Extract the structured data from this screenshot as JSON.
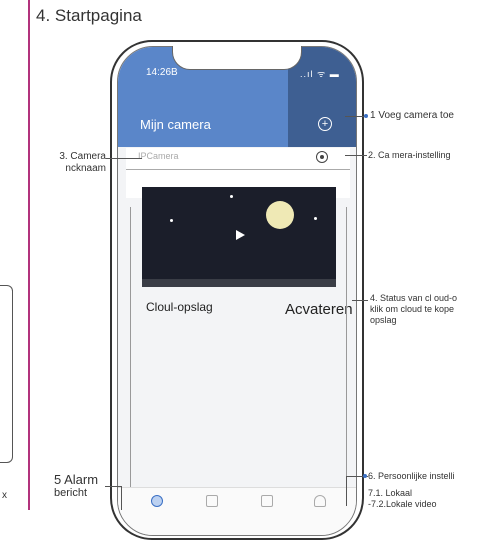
{
  "page": {
    "title": "4. Startpagina"
  },
  "phone": {
    "status_time": "14:26B",
    "status_icons": "..ıl ᯤ ▬",
    "header_title": "Mijn camera",
    "camera_nickname": "IPCamera",
    "cloud_label": "Cloul-opslag",
    "activate_label": "Acvateren",
    "tabs": [
      "camera",
      "alarm",
      "gallery",
      "profile"
    ]
  },
  "callouts": {
    "c1": "1 Voeg camera toe",
    "c2": "2. Ca mera-instelling",
    "c3_line1": "3. Camera",
    "c3_line2": "ncknaam",
    "c4_line1": "4. Status van cl oud-o",
    "c4_line2": "klik om cloud te kope",
    "c4_line3": "opslag",
    "c5_line1": "5 Alarm",
    "c5_line2": "bericht",
    "c6": "6. Persoonlijke instelli",
    "c7_line1": "7.1. Lokaal",
    "c7_line2": "-7.2.Lokale video"
  },
  "left_fragment": {
    "x_char": "x"
  },
  "colors": {
    "header_blue": "#5a86c9",
    "header_dark": "#3e5f92",
    "sidebar_rule": "#b2327c"
  }
}
